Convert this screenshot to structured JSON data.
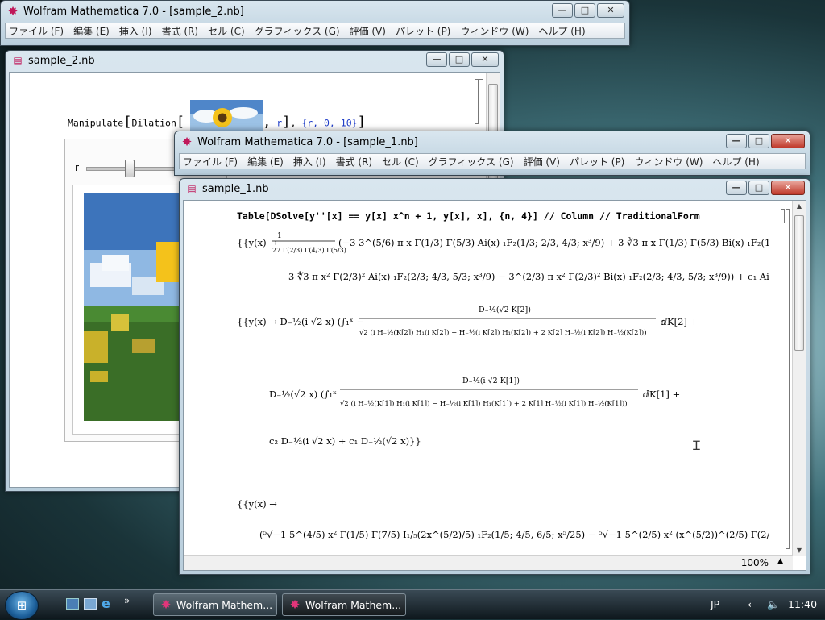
{
  "main_window": {
    "title": "Wolfram Mathematica 7.0 - [sample_2.nb]",
    "menu": [
      "ファイル (F)",
      "編集 (E)",
      "挿入 (I)",
      "書式 (R)",
      "セル (C)",
      "グラフィックス (G)",
      "評価 (V)",
      "パレット (P)",
      "ウィンドウ (W)",
      "ヘルプ (H)"
    ]
  },
  "notebook2": {
    "title": "sample_2.nb",
    "input_parts": {
      "fn": "Manipulate",
      "inner": "Dilation",
      "arg": "r",
      "spec": "{r, 0, 10}"
    },
    "slider_label": "r",
    "slider_value": 0.2
  },
  "second_window": {
    "title": "Wolfram Mathematica 7.0 - [sample_1.nb]",
    "menu": [
      "ファイル (F)",
      "編集 (E)",
      "挿入 (I)",
      "書式 (R)",
      "セル (C)",
      "グラフィックス (G)",
      "評価 (V)",
      "パレット (P)",
      "ウィンドウ (W)",
      "ヘルプ (H)"
    ]
  },
  "notebook1": {
    "title": "sample_1.nb",
    "input": "Table[DSolve[y''[x] == y[x] x^n + 1, y[x], x], {n, 4}] // Column // TraditionalForm",
    "zoom": "100%"
  },
  "taskbar": {
    "buttons": [
      "Wolfram Mathem...",
      "Wolfram Mathem..."
    ],
    "language": "JP",
    "time": "11:40"
  },
  "colors": {
    "input_blue": "#1e3cc8",
    "close_red": "#c0392b",
    "app_icon": "#c0185a"
  }
}
